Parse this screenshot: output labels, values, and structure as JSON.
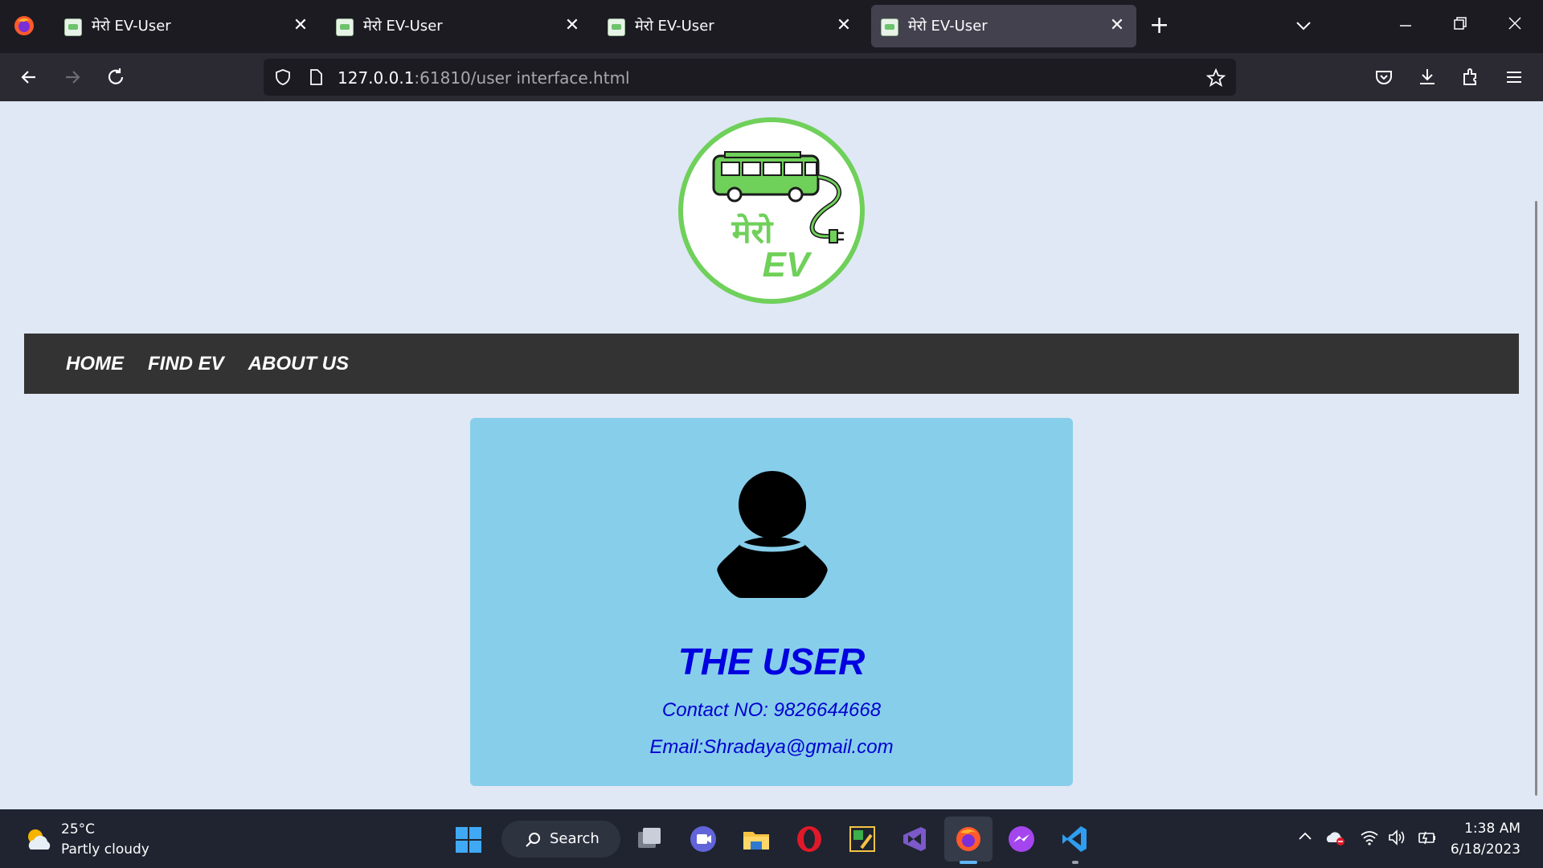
{
  "browser": {
    "tabs": [
      {
        "title": "मेरो EV-User",
        "active": false
      },
      {
        "title": "मेरो EV-User",
        "active": false
      },
      {
        "title": "मेरो EV-User",
        "active": false
      },
      {
        "title": "मेरो EV-User",
        "active": true
      }
    ],
    "url_host": "127.0.0.1",
    "url_rest": ":61810/user interface.html"
  },
  "site": {
    "logo_text_top": "मेरो",
    "logo_text_bottom": "EV",
    "nav": [
      "HOME",
      "FIND EV",
      "ABOUT US"
    ],
    "profile": {
      "name": "THE USER",
      "contact": "Contact NO: 9826644668",
      "email": "Email:Shradaya@gmail.com"
    }
  },
  "taskbar": {
    "weather_temp": "25°C",
    "weather_desc": "Partly cloudy",
    "search_label": "Search",
    "time": "1:38 AM",
    "date": "6/18/2023"
  },
  "colors": {
    "accent_green": "#6fd05a",
    "card_bg": "#87ceeb",
    "title_blue": "#0000e0",
    "nav_bg": "#333333"
  }
}
